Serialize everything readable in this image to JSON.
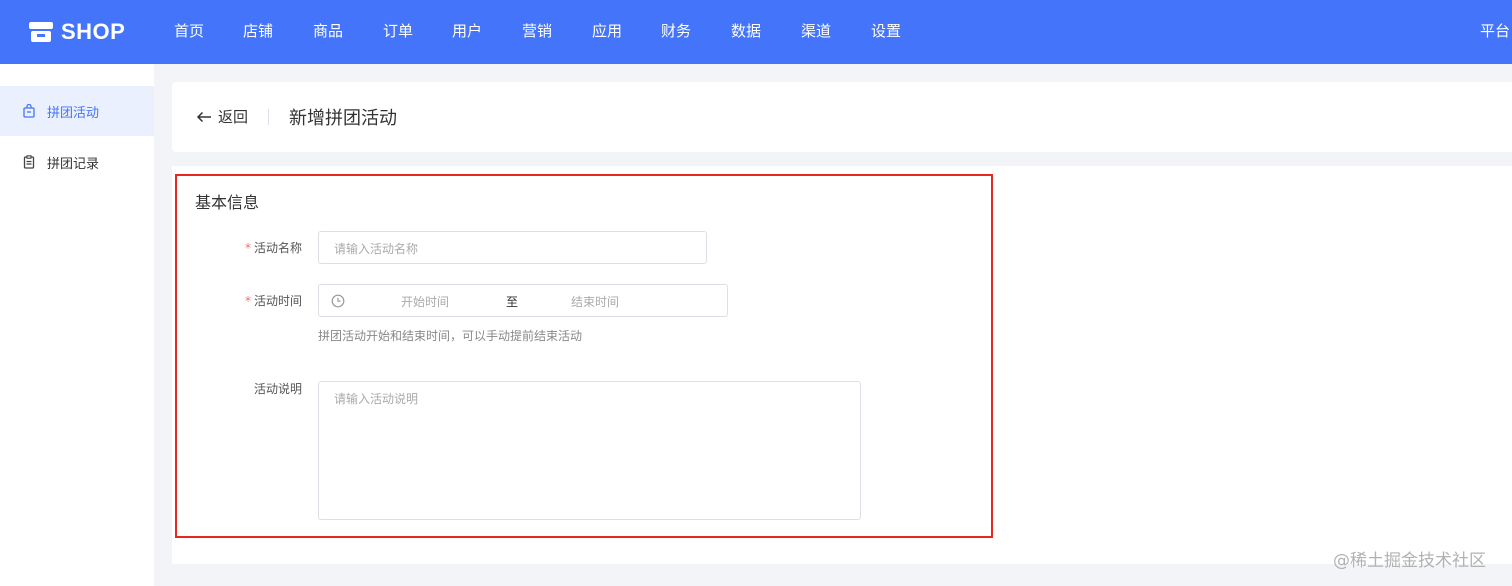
{
  "app": {
    "logo_text": "SHOP",
    "platform_label": "平台"
  },
  "nav": {
    "items": [
      "首页",
      "店铺",
      "商品",
      "订单",
      "用户",
      "营销",
      "应用",
      "财务",
      "数据",
      "渠道",
      "设置"
    ]
  },
  "sidebar": {
    "items": [
      {
        "label": "拼团活动",
        "icon": "bag-icon",
        "active": true
      },
      {
        "label": "拼团记录",
        "icon": "clipboard-icon",
        "active": false
      }
    ]
  },
  "header": {
    "back_label": "返回",
    "title": "新增拼团活动"
  },
  "form": {
    "section_title": "基本信息",
    "name": {
      "label": "活动名称",
      "required": "*",
      "placeholder": "请输入活动名称"
    },
    "time": {
      "label": "活动时间",
      "required": "*",
      "start_placeholder": "开始时间",
      "separator": "至",
      "end_placeholder": "结束时间",
      "hint": "拼团活动开始和结束时间，可以手动提前结束活动"
    },
    "description": {
      "label": "活动说明",
      "placeholder": "请输入活动说明"
    }
  },
  "watermark": "@稀土掘金技术社区",
  "colors": {
    "brand": "#4374fa",
    "highlight_border": "#e8281e",
    "required": "#f56c6c",
    "active_bg": "#eaf0fe"
  }
}
